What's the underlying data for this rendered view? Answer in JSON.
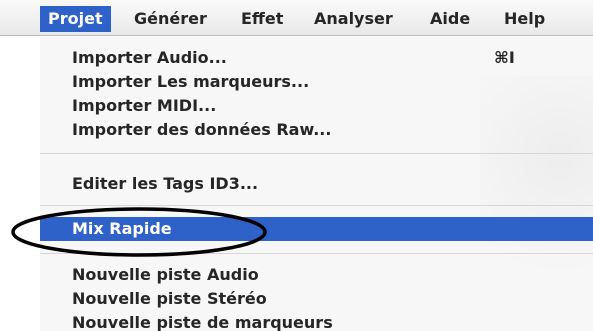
{
  "menubar": {
    "items": [
      {
        "label": "Projet",
        "active": true
      },
      {
        "label": "Générer",
        "active": false
      },
      {
        "label": "Effet",
        "active": false
      },
      {
        "label": "Analyser",
        "active": false
      },
      {
        "label": "Aide",
        "active": false
      },
      {
        "label": "Help",
        "active": false
      }
    ]
  },
  "menu": {
    "items": [
      {
        "label": "Importer Audio...",
        "shortcut": "⌘I"
      },
      {
        "label": "Importer Les marqueurs..."
      },
      {
        "label": "Importer MIDI..."
      },
      {
        "label": "Importer des données Raw..."
      },
      {
        "label": "Editer les Tags ID3..."
      },
      {
        "label": "Mix Rapide",
        "highlighted": true
      },
      {
        "label": "Nouvelle piste Audio"
      },
      {
        "label": "Nouvelle piste Stéréo"
      },
      {
        "label": "Nouvelle piste de marqueurs"
      }
    ]
  },
  "colors": {
    "highlight": "#2f62c8",
    "menu_background": "#f7f7f7",
    "annotation": "#000000"
  }
}
